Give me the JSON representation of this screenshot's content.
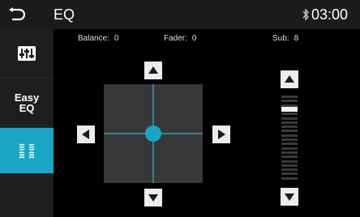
{
  "header": {
    "title": "EQ",
    "time": "03:00"
  },
  "icons": {
    "back": "back-arrow-icon",
    "bluetooth": "bluetooth-icon",
    "eq_settings": "equalizer-sliders-icon",
    "sound_field": "sound-field-icon"
  },
  "sidebar": {
    "easy_eq_line1": "Easy",
    "easy_eq_line2": "EQ",
    "active_index": 2
  },
  "balance": {
    "label": "Balance:",
    "value": "0"
  },
  "fader": {
    "label": "Fader:",
    "value": "0"
  },
  "sub": {
    "label": "Sub:",
    "value": "8"
  },
  "colors": {
    "accent": "#1aa5c4",
    "panel": "#383838",
    "sidebar": "#1e1e1e",
    "topbar": "#1b1b1b"
  }
}
